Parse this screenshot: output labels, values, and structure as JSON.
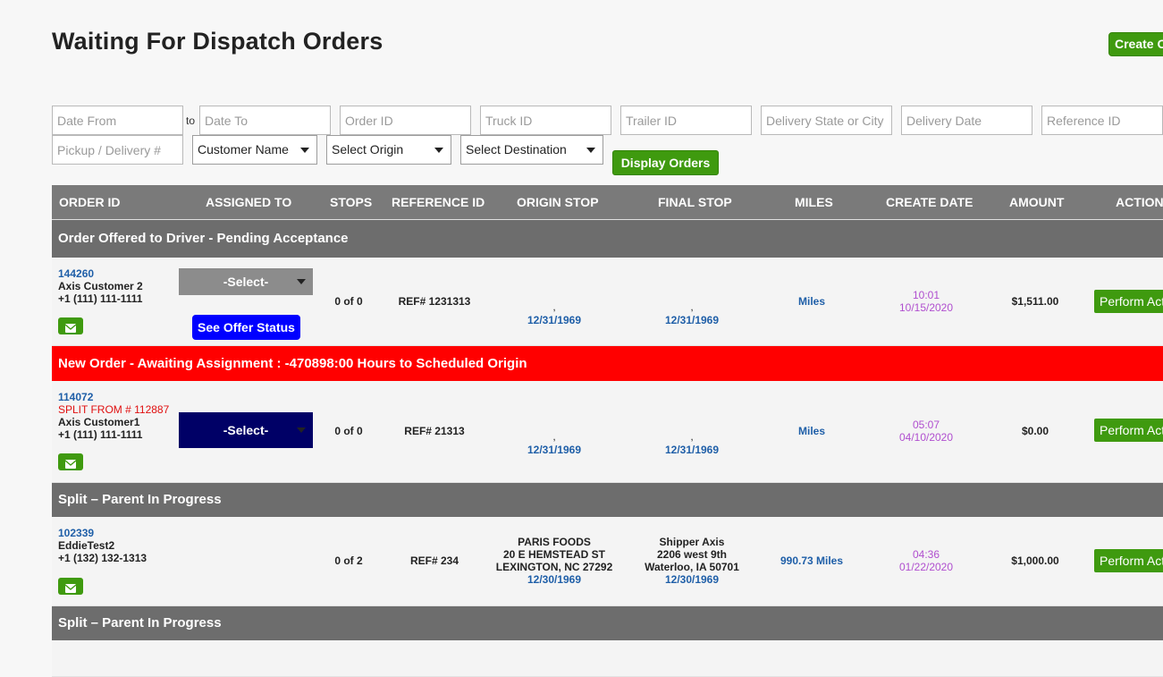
{
  "page": {
    "title": "Waiting For Dispatch Orders",
    "create_button": "Create Order"
  },
  "filters": {
    "date_from": "Date From",
    "to_label": "to",
    "date_to": "Date To",
    "order_id": "Order ID",
    "truck_id": "Truck ID",
    "trailer_id": "Trailer ID",
    "delivery_state_city": "Delivery State or City",
    "delivery_date": "Delivery Date",
    "reference_id": "Reference ID",
    "pickup_delivery": "Pickup / Delivery #",
    "customer_name": "Customer Name",
    "select_origin": "Select Origin",
    "select_destination": "Select Destination",
    "display_button": "Display Orders"
  },
  "table": {
    "headers": {
      "order_id": "ORDER ID",
      "assigned_to": "ASSIGNED TO",
      "stops": "STOPS",
      "reference_id": "REFERENCE ID",
      "origin_stop": "ORIGIN STOP",
      "final_stop": "FINAL STOP",
      "miles": "MILES",
      "create_date": "CREATE DATE",
      "amount": "AMOUNT",
      "action": "ACTION"
    },
    "groups": [
      {
        "title": "Order Offered to Driver - Pending Acceptance",
        "row": {
          "order_id": "144260",
          "customer": "Axis Customer 2",
          "phone": "+1 (111) 111-1111",
          "assign_select": "-Select-",
          "offer_button": "See Offer Status",
          "stops": "0 of 0",
          "reference": "REF# 1231313",
          "origin_sep": ",",
          "origin_date": "12/31/1969",
          "final_sep": ",",
          "final_date": "12/31/1969",
          "miles": "Miles",
          "create_time": "10:01",
          "create_date": "10/15/2020",
          "amount": "$1,511.00",
          "action_button": "Perform Action"
        }
      },
      {
        "title": "New Order - Awaiting Assignment : -470898:00 Hours to Scheduled Origin",
        "row": {
          "order_id": "114072",
          "split_from": "SPLIT FROM # 112887",
          "customer": "Axis Customer1",
          "phone": "+1 (111) 111-1111",
          "assign_select": "-Select-",
          "stops": "0 of 0",
          "reference": "REF# 21313",
          "origin_sep": ",",
          "origin_date": "12/31/1969",
          "final_sep": ",",
          "final_date": "12/31/1969",
          "miles": "Miles",
          "create_time": "05:07",
          "create_date": "04/10/2020",
          "amount": "$0.00",
          "action_button": "Perform Action"
        }
      },
      {
        "title": "Split – Parent In Progress",
        "row": {
          "order_id": "102339",
          "customer": "EddieTest2",
          "phone": "+1 (132) 132-1313",
          "stops": "0 of 2",
          "reference": "REF# 234",
          "origin_name": "PARIS FOODS",
          "origin_street": "20 E HEMSTEAD ST",
          "origin_city": "LEXINGTON, NC 27292",
          "origin_date": "12/30/1969",
          "final_name": "Shipper Axis",
          "final_street": "2206 west 9th",
          "final_city": "Waterloo, IA 50701",
          "final_date": "12/30/1969",
          "miles": "990.73 Miles",
          "create_time": "04:36",
          "create_date": "01/22/2020",
          "amount": "$1,000.00",
          "action_button": "Perform Action"
        }
      },
      {
        "title": "Split – Parent In Progress"
      }
    ]
  },
  "colors": {
    "accent_green": "#3f9a0f",
    "header_grey": "#7a7a7a",
    "group_grey": "#6d6d6d",
    "alert_red": "#ff0000",
    "link_blue": "#1f5fa8",
    "date_purple": "#b04fcf"
  },
  "icons": {
    "mail": "envelope-icon",
    "dropdown": "chevron-down-icon"
  }
}
